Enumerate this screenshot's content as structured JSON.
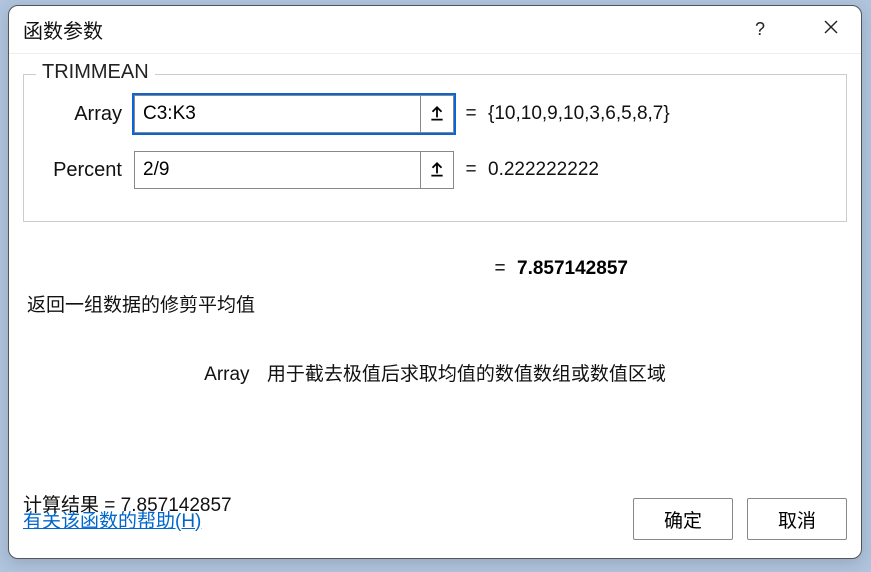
{
  "title": "函数参数",
  "function_name": "TRIMMEAN",
  "params": {
    "array": {
      "label": "Array",
      "value": "C3:K3",
      "preview": "{10,10,9,10,3,6,5,8,7}"
    },
    "percent": {
      "label": "Percent",
      "value": "2/9",
      "preview": "0.222222222"
    }
  },
  "result": "7.857142857",
  "description": "返回一组数据的修剪平均值",
  "param_desc_label": "Array",
  "param_desc_text": "用于截去极值后求取均值的数值数组或数值区域",
  "calc_result_label": "计算结果 = ",
  "calc_result_value": "7.857142857",
  "help_link": "有关该函数的帮助(H)",
  "ok_button": "确定",
  "cancel_button": "取消"
}
